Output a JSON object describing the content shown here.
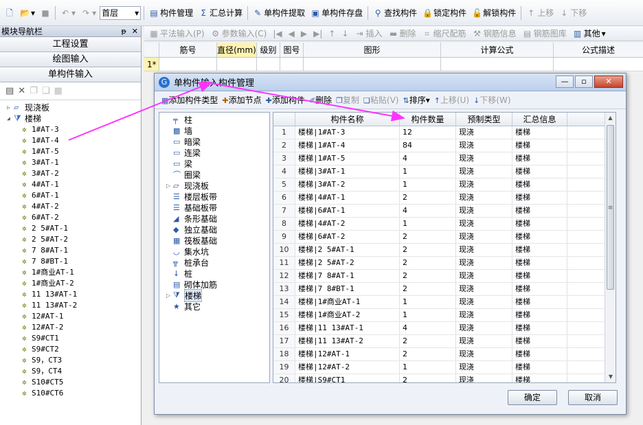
{
  "toolbar": {
    "floor": "首层",
    "buttons": [
      "构件管理",
      "汇总计算",
      "单构件提取",
      "单构件存盘",
      "查找构件",
      "锁定构件",
      "解锁构件",
      "上移",
      "下移"
    ]
  },
  "nav": {
    "title": "模块导航栏",
    "sections": [
      "工程设置",
      "绘图输入",
      "单构件输入"
    ],
    "tree_parents": [
      "现浇板",
      "楼梯"
    ],
    "tree_children": [
      "1#AT-3",
      "1#AT-4",
      "1#AT-5",
      "3#AT-1",
      "3#AT-2",
      "4#AT-1",
      "6#AT-1",
      "4#AT-2",
      "6#AT-2",
      "2 5#AT-1",
      "2 5#AT-2",
      "7 8#AT-1",
      "7 8#BT-1",
      "1#商业AT-1",
      "1#商业AT-2",
      "11 13#AT-1",
      "11 13#AT-2",
      "12#AT-1",
      "12#AT-2",
      "S9#CT1",
      "S9#CT2",
      "S9，CT3",
      "S9，CT4",
      "S10#CT5",
      "S10#CT6"
    ]
  },
  "rebar_toolbar": [
    "平法输入(P)",
    "参数输入(C)",
    "插入",
    "删除",
    "缩尺配筋",
    "钢筋信息",
    "钢筋图库",
    "其他"
  ],
  "grid": {
    "headers": [
      "筋号",
      "直径(mm)",
      "级别",
      "图号",
      "图形",
      "计算公式",
      "公式描述"
    ],
    "row_label": "1*"
  },
  "dialog": {
    "title": "单构件输入构件管理",
    "tools": [
      "添加构件类型",
      "添加节点",
      "添加构件",
      "删除",
      "复制",
      "粘贴(V)",
      "排序",
      "上移(U)",
      "下移(W)"
    ],
    "types": [
      "柱",
      "墙",
      "暗梁",
      "连梁",
      "梁",
      "圈梁",
      "现浇板",
      "楼层板带",
      "基础板带",
      "条形基础",
      "独立基础",
      "筏板基础",
      "集水坑",
      "桩承台",
      "桩",
      "砌体加筋",
      "楼梯",
      "其它"
    ],
    "list_headers": [
      "构件名称",
      "构件数量",
      "预制类型",
      "汇总信息"
    ],
    "rows": [
      {
        "idx": "1",
        "name": "楼梯|1#AT-3",
        "qty": "12",
        "type": "现浇",
        "sum": "楼梯"
      },
      {
        "idx": "2",
        "name": "楼梯|1#AT-4",
        "qty": "84",
        "type": "现浇",
        "sum": "楼梯"
      },
      {
        "idx": "3",
        "name": "楼梯|1#AT-5",
        "qty": "4",
        "type": "现浇",
        "sum": "楼梯"
      },
      {
        "idx": "4",
        "name": "楼梯|3#AT-1",
        "qty": "1",
        "type": "现浇",
        "sum": "楼梯"
      },
      {
        "idx": "5",
        "name": "楼梯|3#AT-2",
        "qty": "1",
        "type": "现浇",
        "sum": "楼梯"
      },
      {
        "idx": "6",
        "name": "楼梯|4#AT-1",
        "qty": "2",
        "type": "现浇",
        "sum": "楼梯"
      },
      {
        "idx": "7",
        "name": "楼梯|6#AT-1",
        "qty": "4",
        "type": "现浇",
        "sum": "楼梯"
      },
      {
        "idx": "8",
        "name": "楼梯|4#AT-2",
        "qty": "1",
        "type": "现浇",
        "sum": "楼梯"
      },
      {
        "idx": "9",
        "name": "楼梯|6#AT-2",
        "qty": "2",
        "type": "现浇",
        "sum": "楼梯"
      },
      {
        "idx": "10",
        "name": "楼梯|2 5#AT-1",
        "qty": "2",
        "type": "现浇",
        "sum": "楼梯"
      },
      {
        "idx": "11",
        "name": "楼梯|2 5#AT-2",
        "qty": "2",
        "type": "现浇",
        "sum": "楼梯"
      },
      {
        "idx": "12",
        "name": "楼梯|7 8#AT-1",
        "qty": "2",
        "type": "现浇",
        "sum": "楼梯"
      },
      {
        "idx": "13",
        "name": "楼梯|7 8#BT-1",
        "qty": "2",
        "type": "现浇",
        "sum": "楼梯"
      },
      {
        "idx": "14",
        "name": "楼梯|1#商业AT-1",
        "qty": "1",
        "type": "现浇",
        "sum": "楼梯"
      },
      {
        "idx": "15",
        "name": "楼梯|1#商业AT-2",
        "qty": "1",
        "type": "现浇",
        "sum": "楼梯"
      },
      {
        "idx": "16",
        "name": "楼梯|11 13#AT-1",
        "qty": "4",
        "type": "现浇",
        "sum": "楼梯"
      },
      {
        "idx": "17",
        "name": "楼梯|11 13#AT-2",
        "qty": "2",
        "type": "现浇",
        "sum": "楼梯"
      },
      {
        "idx": "18",
        "name": "楼梯|12#AT-1",
        "qty": "2",
        "type": "现浇",
        "sum": "楼梯"
      },
      {
        "idx": "19",
        "name": "楼梯|12#AT-2",
        "qty": "1",
        "type": "现浇",
        "sum": "楼梯"
      },
      {
        "idx": "20",
        "name": "楼梯|S9#CT1",
        "qty": "2",
        "type": "现浇",
        "sum": "楼梯"
      }
    ],
    "ok_label": "确定",
    "cancel_label": "取消"
  },
  "colors": {
    "arrow": "#ff33ff",
    "accent": "#2a5aa8"
  }
}
